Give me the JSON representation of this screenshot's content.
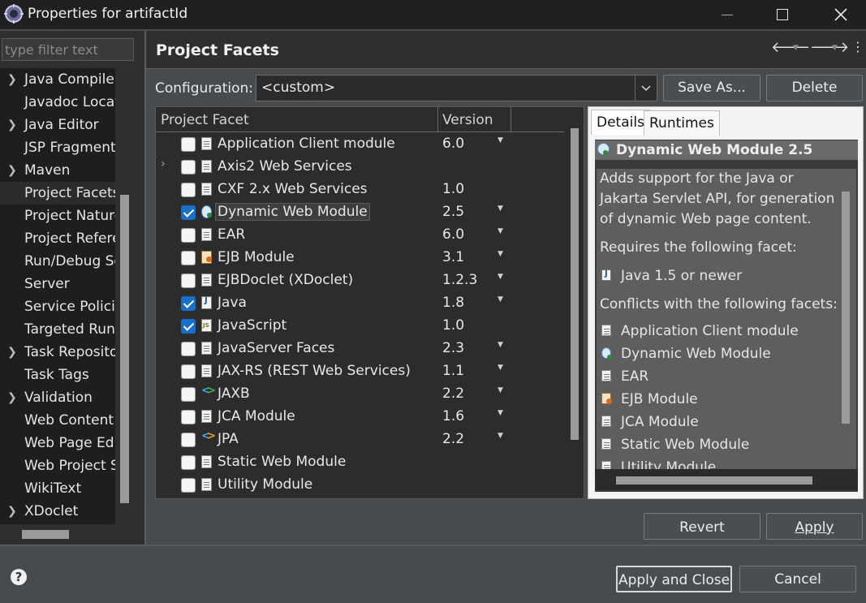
{
  "window": {
    "title": "Properties for artifactId",
    "controls": [
      "minimize",
      "maximize",
      "close"
    ]
  },
  "nav": {
    "filter_placeholder": "type filter text",
    "items": [
      {
        "label": "Java Compiler",
        "expandable": true
      },
      {
        "label": "Javadoc Location",
        "expandable": false
      },
      {
        "label": "Java Editor",
        "expandable": true
      },
      {
        "label": "JSP Fragment",
        "expandable": false
      },
      {
        "label": "Maven",
        "expandable": true
      },
      {
        "label": "Project Facets",
        "expandable": false,
        "selected": true
      },
      {
        "label": "Project Natures",
        "expandable": false
      },
      {
        "label": "Project References",
        "expandable": false
      },
      {
        "label": "Run/Debug Settings",
        "expandable": false
      },
      {
        "label": "Server",
        "expandable": false
      },
      {
        "label": "Service Policies",
        "expandable": false
      },
      {
        "label": "Targeted Runtimes",
        "expandable": false
      },
      {
        "label": "Task Repository",
        "expandable": true
      },
      {
        "label": "Task Tags",
        "expandable": false
      },
      {
        "label": "Validation",
        "expandable": true
      },
      {
        "label": "Web Content Settings",
        "expandable": false
      },
      {
        "label": "Web Page Editor",
        "expandable": false
      },
      {
        "label": "Web Project Settings",
        "expandable": false
      },
      {
        "label": "WikiText",
        "expandable": false
      },
      {
        "label": "XDoclet",
        "expandable": true
      }
    ]
  },
  "header": {
    "title": "Project Facets"
  },
  "config": {
    "label": "Configuration:",
    "value": "<custom>",
    "save_as": "Save As...",
    "delete": "Delete"
  },
  "facets": {
    "col_facet": "Project Facet",
    "col_version": "Version",
    "rows": [
      {
        "name": "Application Client module",
        "version": "6.0",
        "checked": false,
        "icon": "page-icon",
        "expandable": false,
        "dropdown": true
      },
      {
        "name": "Axis2 Web Services",
        "version": "",
        "checked": false,
        "icon": "page-icon",
        "expandable": true,
        "dropdown": false
      },
      {
        "name": "CXF 2.x Web Services",
        "version": "1.0",
        "checked": false,
        "icon": "page-icon",
        "expandable": false,
        "dropdown": false
      },
      {
        "name": "Dynamic Web Module",
        "version": "2.5",
        "checked": true,
        "icon": "web-module-icon",
        "expandable": false,
        "dropdown": true,
        "highlight": true
      },
      {
        "name": "EAR",
        "version": "6.0",
        "checked": false,
        "icon": "page-icon",
        "expandable": false,
        "dropdown": true
      },
      {
        "name": "EJB Module",
        "version": "3.1",
        "checked": false,
        "icon": "ejb-icon",
        "expandable": false,
        "dropdown": true
      },
      {
        "name": "EJBDoclet (XDoclet)",
        "version": "1.2.3",
        "checked": false,
        "icon": "page-icon",
        "expandable": false,
        "dropdown": true
      },
      {
        "name": "Java",
        "version": "1.8",
        "checked": true,
        "icon": "java-icon",
        "expandable": false,
        "dropdown": true
      },
      {
        "name": "JavaScript",
        "version": "1.0",
        "checked": true,
        "icon": "javascript-icon",
        "expandable": false,
        "dropdown": false
      },
      {
        "name": "JavaServer Faces",
        "version": "2.3",
        "checked": false,
        "icon": "page-icon",
        "expandable": false,
        "dropdown": true
      },
      {
        "name": "JAX-RS (REST Web Services)",
        "version": "1.1",
        "checked": false,
        "icon": "page-icon",
        "expandable": false,
        "dropdown": true
      },
      {
        "name": "JAXB",
        "version": "2.2",
        "checked": false,
        "icon": "jaxb-icon",
        "expandable": false,
        "dropdown": true
      },
      {
        "name": "JCA Module",
        "version": "1.6",
        "checked": false,
        "icon": "page-icon",
        "expandable": false,
        "dropdown": true
      },
      {
        "name": "JPA",
        "version": "2.2",
        "checked": false,
        "icon": "jpa-icon",
        "expandable": false,
        "dropdown": true
      },
      {
        "name": "Static Web Module",
        "version": "",
        "checked": false,
        "icon": "page-icon",
        "expandable": false,
        "dropdown": false
      },
      {
        "name": "Utility Module",
        "version": "",
        "checked": false,
        "icon": "page-icon",
        "expandable": false,
        "dropdown": false
      }
    ]
  },
  "details": {
    "tabs": [
      "Details",
      "Runtimes"
    ],
    "title": "Dynamic Web Module 2.5",
    "description": [
      "Adds support for the Java or",
      "Jakarta Servlet API, for generation",
      "of dynamic Web page content."
    ],
    "requires_label": "Requires the following facet:",
    "requires": [
      {
        "name": "Java 1.5 or newer",
        "icon": "java-icon"
      }
    ],
    "conflicts_label": "Conflicts with the following facets:",
    "conflicts": [
      {
        "name": "Application Client module",
        "icon": "page-icon"
      },
      {
        "name": "Dynamic Web Module",
        "icon": "web-module-icon"
      },
      {
        "name": "EAR",
        "icon": "page-icon"
      },
      {
        "name": "EJB Module",
        "icon": "ejb-icon"
      },
      {
        "name": "JCA Module",
        "icon": "page-icon"
      },
      {
        "name": "Static Web Module",
        "icon": "page-icon"
      },
      {
        "name": "Utility Module",
        "icon": "page-icon"
      }
    ]
  },
  "actions": {
    "revert": "Revert",
    "apply": "Apply",
    "apply_close": "Apply and Close",
    "cancel": "Cancel",
    "help": "?"
  }
}
